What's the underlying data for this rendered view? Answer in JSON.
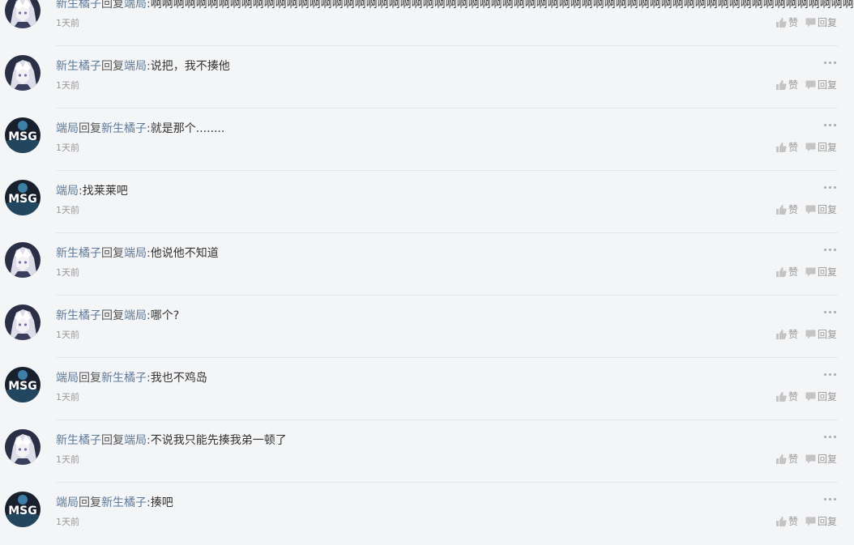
{
  "comments": [
    {
      "avatar": "white-hair-anime-avatar",
      "author": "新生橘子",
      "verb": "回复",
      "target": "端局",
      "colon": ":",
      "text": "啊啊啊啊啊啊啊啊啊啊啊啊啊啊啊啊啊啊啊啊啊啊啊啊啊啊啊啊啊啊啊啊啊啊啊啊啊啊啊啊啊啊啊啊啊啊啊啊啊啊啊啊啊啊啊啊啊啊啊啊啊啊啊啊",
      "time": "1天前",
      "like": "赞",
      "reply": "回复"
    },
    {
      "avatar": "white-hair-anime-avatar",
      "author": "新生橘子",
      "verb": "回复",
      "target": "端局",
      "colon": ":",
      "text": "说把，我不揍他",
      "time": "1天前",
      "like": "赞",
      "reply": "回复"
    },
    {
      "avatar": "msg-team-avatar",
      "author": "端局",
      "verb": "回复",
      "target": "新生橘子",
      "colon": ":",
      "text": "就是那个........",
      "time": "1天前",
      "like": "赞",
      "reply": "回复"
    },
    {
      "avatar": "msg-team-avatar",
      "author": "端局",
      "verb": "",
      "target": "",
      "colon": ":",
      "text": "找莱莱吧",
      "time": "1天前",
      "like": "赞",
      "reply": "回复"
    },
    {
      "avatar": "white-hair-anime-avatar",
      "author": "新生橘子",
      "verb": "回复",
      "target": "端局",
      "colon": ":",
      "text": "他说他不知道",
      "time": "1天前",
      "like": "赞",
      "reply": "回复"
    },
    {
      "avatar": "white-hair-anime-avatar",
      "author": "新生橘子",
      "verb": "回复",
      "target": "端局",
      "colon": ":",
      "text": "哪个?",
      "time": "1天前",
      "like": "赞",
      "reply": "回复"
    },
    {
      "avatar": "msg-team-avatar",
      "author": "端局",
      "verb": "回复",
      "target": "新生橘子",
      "colon": ":",
      "text": "我也不鸡岛",
      "time": "1天前",
      "like": "赞",
      "reply": "回复"
    },
    {
      "avatar": "white-hair-anime-avatar",
      "author": "新生橘子",
      "verb": "回复",
      "target": "端局",
      "colon": ":",
      "text": "不说我只能先揍我弟一顿了",
      "time": "1天前",
      "like": "赞",
      "reply": "回复"
    },
    {
      "avatar": "msg-team-avatar",
      "author": "端局",
      "verb": "回复",
      "target": "新生橘子",
      "colon": ":",
      "text": "揍吧",
      "time": "1天前",
      "like": "赞",
      "reply": "回复"
    }
  ],
  "avatar_texts": {
    "msg-team-avatar": "MSG"
  },
  "colors": {
    "link_name": "#5d7a9a",
    "meta": "#999999",
    "divider": "#e6e6e6",
    "background": "#f4f5f7"
  }
}
